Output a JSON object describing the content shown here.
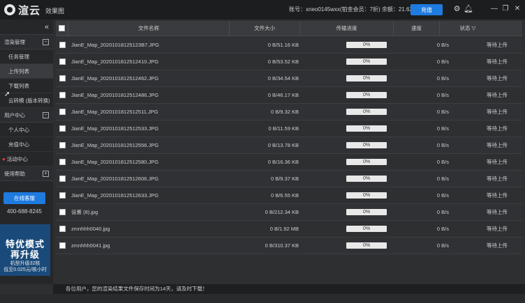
{
  "app": {
    "logo": "渲云",
    "subtitle": "效果图"
  },
  "account": {
    "text": "账号：xneo0145wxx(铂金会员：7折) 余额：21.62",
    "recharge_label": "充值"
  },
  "icons": {
    "settings": "gear-icon",
    "bell": "bell-icon",
    "minimize": "minimize-icon",
    "restore": "restore-icon",
    "close": "close-icon"
  },
  "sidebar": {
    "collapse_icon": "«",
    "groups": [
      {
        "label": "渲染管理",
        "toggle": "−",
        "items": [
          "任务管理",
          "上传列表",
          "下载列表",
          "云转模 (版本转换)"
        ]
      },
      {
        "label": "用户中心",
        "toggle": "−",
        "items": [
          "个人中心",
          "充值中心",
          "活动中心"
        ]
      },
      {
        "label": "使用帮助",
        "toggle": "+",
        "items": []
      }
    ],
    "service_button": "在线客服",
    "phone": "400-688-8245",
    "banner": {
      "line1": "特优模式",
      "line2": "再升级",
      "line3": "机型升级32核",
      "line4": "低至0.025元/核小时"
    }
  },
  "table": {
    "headers": {
      "name": "文件名称",
      "size": "文件大小",
      "progress": "传输进度",
      "speed": "速度",
      "status": "状态"
    },
    "filter_icon": "▽",
    "rows": [
      {
        "name": "JianE_Map_20201018125123B7.JPG",
        "size": "0 B/51.16 KB",
        "progress": "0%",
        "speed": "0 B/s",
        "status": "等待上传"
      },
      {
        "name": "JianE_Map_2020101812512410.JPG",
        "size": "0 B/53.52 KB",
        "progress": "0%",
        "speed": "0 B/s",
        "status": "等待上传"
      },
      {
        "name": "JianE_Map_2020101812512462.JPG",
        "size": "0 B/34.54 KB",
        "progress": "0%",
        "speed": "0 B/s",
        "status": "等待上传"
      },
      {
        "name": "JianE_Map_2020101812512486.JPG",
        "size": "0 B/46.17 KB",
        "progress": "0%",
        "speed": "0 B/s",
        "status": "等待上传"
      },
      {
        "name": "JianE_Map_2020101812512511.JPG",
        "size": "0 B/9.32 KB",
        "progress": "0%",
        "speed": "0 B/s",
        "status": "等待上传"
      },
      {
        "name": "JianE_Map_2020101812512533.JPG",
        "size": "0 B/11.59 KB",
        "progress": "0%",
        "speed": "0 B/s",
        "status": "等待上传"
      },
      {
        "name": "JianE_Map_2020101812512556.JPG",
        "size": "0 B/13.78 KB",
        "progress": "0%",
        "speed": "0 B/s",
        "status": "等待上传"
      },
      {
        "name": "JianE_Map_2020101812512580.JPG",
        "size": "0 B/16.36 KB",
        "progress": "0%",
        "speed": "0 B/s",
        "status": "等待上传"
      },
      {
        "name": "JianE_Map_2020101812512606.JPG",
        "size": "0 B/9.37 KB",
        "progress": "0%",
        "speed": "0 B/s",
        "status": "等待上传"
      },
      {
        "name": "JianE_Map_2020101812512633.JPG",
        "size": "0 B/6.55 KB",
        "progress": "0%",
        "speed": "0 B/s",
        "status": "等待上传"
      },
      {
        "name": "设置 (8).jpg",
        "size": "0 B/212.34 KB",
        "progress": "0%",
        "speed": "0 B/s",
        "status": "等待上传"
      },
      {
        "name": "zmnhhh0040.jpg",
        "size": "0 B/1.92 MB",
        "progress": "0%",
        "speed": "0 B/s",
        "status": "等待上传"
      },
      {
        "name": "zmnhhh0041.jpg",
        "size": "0 B/310.37 KB",
        "progress": "0%",
        "speed": "0 B/s",
        "status": "等待上传"
      }
    ]
  },
  "statusbar": "各位用户，您的渲染结果文件保存时间为14天，请及时下载！"
}
